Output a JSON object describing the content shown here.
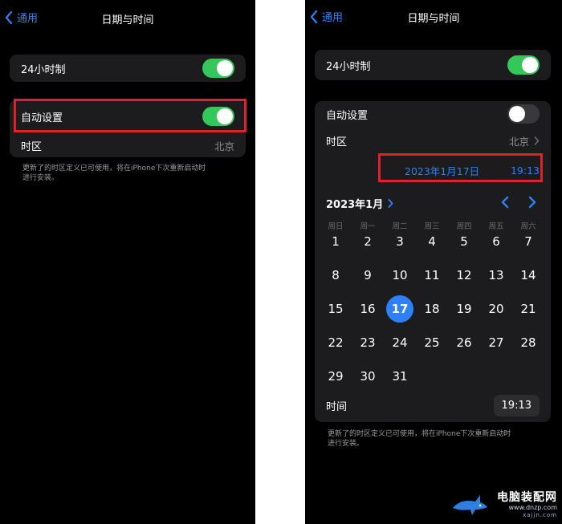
{
  "left": {
    "nav": {
      "back_label": "通用",
      "title": "日期与时间"
    },
    "settings": {
      "hour24": {
        "label": "24小时制",
        "state": "on"
      },
      "auto": {
        "label": "自动设置",
        "state": "on"
      },
      "timezone": {
        "label": "时区",
        "value": "北京"
      }
    },
    "footnote_line1": "更新了的时区定义已可使用，将在iPhone下次重新启动时",
    "footnote_line2": "进行安装。"
  },
  "right": {
    "nav": {
      "back_label": "通用",
      "title": "日期与时间"
    },
    "settings": {
      "hour24": {
        "label": "24小时制",
        "state": "on"
      },
      "auto": {
        "label": "自动设置",
        "state": "off"
      },
      "timezone": {
        "label": "时区",
        "value": "北京"
      }
    },
    "selected_date": "2023年1月17日",
    "selected_time": "19:13",
    "calendar": {
      "month_label": "2023年1月",
      "weekdays": [
        "周日",
        "周一",
        "周二",
        "周三",
        "周四",
        "周五",
        "周六"
      ],
      "first_weekday_index": 0,
      "days_in_month": 31,
      "selected_day": 17
    },
    "time": {
      "label": "时间",
      "value": "19:13"
    },
    "footnote_line1": "更新了的时区定义已可使用，将在iPhone下次重新启动时",
    "footnote_line2": "进行安装。"
  },
  "colors": {
    "accent_blue": "#2f80f6",
    "toggle_green": "#34c759",
    "highlight_red": "#e0212a",
    "group_bg": "#1c1c1e"
  },
  "watermark": {
    "title": "电脑装配网",
    "url": "www.dnzp.com",
    "sub": "xajjn.com"
  }
}
